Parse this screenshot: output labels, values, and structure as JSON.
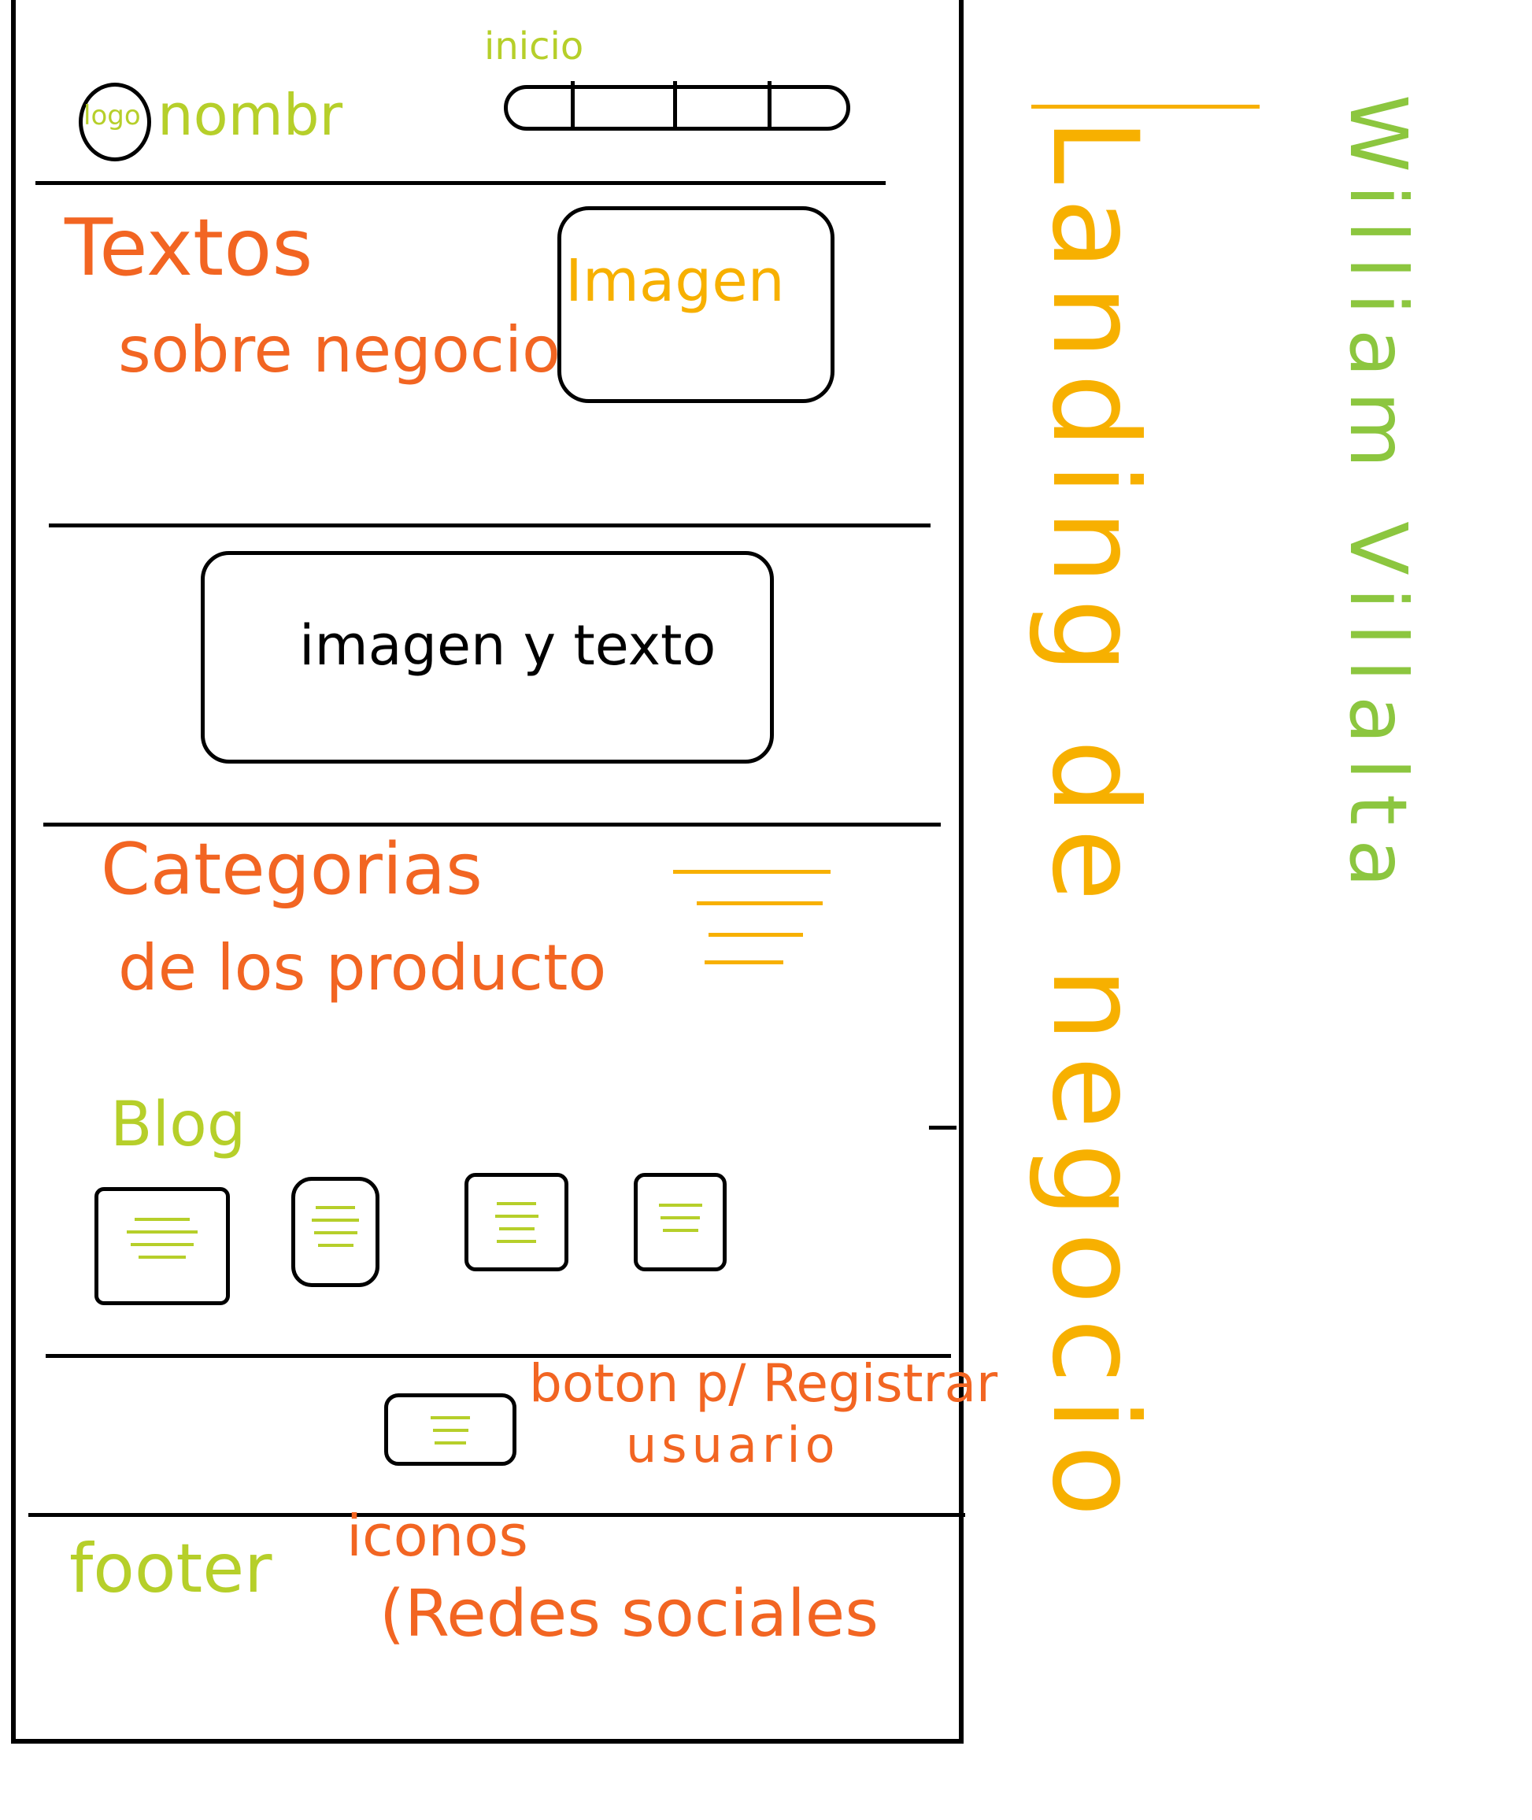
{
  "header": {
    "logo_label": "logo",
    "brand_name": "nombr",
    "nav_label": "inicio"
  },
  "hero": {
    "text_label_line1": "Textos",
    "text_label_line2": "sobre negocio",
    "image_label": "Imagen"
  },
  "feature": {
    "box_label": "imagen y texto"
  },
  "categories": {
    "label_line1": "Categorias",
    "label_line2": "de los producto"
  },
  "blog": {
    "label": "Blog",
    "tile_count_note": ""
  },
  "register": {
    "label_line1": "boton p/ Registrar",
    "label_line2": "usuario"
  },
  "footer": {
    "label": "footer",
    "icons_label_line1": "iconos",
    "icons_label_line2": "(Redes sociales"
  },
  "side": {
    "title_vertical": "Landing de negocio",
    "author_vertical": "William Villalta"
  },
  "colors": {
    "lime": "#b6cf2a",
    "green": "#8cc63f",
    "orange": "#f26522",
    "amber": "#f7b000",
    "ink": "#000000"
  }
}
